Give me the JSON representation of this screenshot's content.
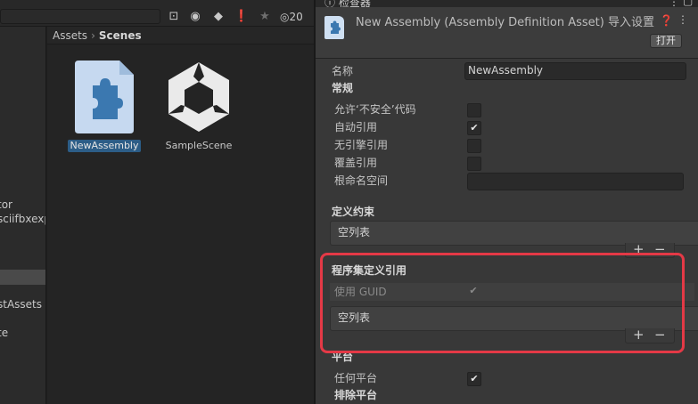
{
  "project": {
    "toolbar_icons": [
      "scene-filter-icon",
      "palette-icon",
      "label-icon",
      "info-icon",
      "favorite-icon",
      "eye-hidden-icon"
    ],
    "hidden_count": "20",
    "tree_items": [
      "tor",
      "sciifbxexp",
      "stAssets",
      "te"
    ],
    "breadcrumb": {
      "root": "Assets",
      "separator": "›",
      "current": "Scenes"
    },
    "assets": [
      {
        "label": "NewAssembly",
        "icon": "assembly-definition-icon",
        "selected": true
      },
      {
        "label": "SampleScene",
        "icon": "unity-scene-icon",
        "selected": false
      }
    ]
  },
  "inspector": {
    "tab_label": "检查器",
    "title": "New Assembly (Assembly Definition Asset) 导入设置",
    "open_button": "打开",
    "name_label": "名称",
    "name_value": "NewAssembly",
    "general_title": "常规",
    "general_rows": [
      {
        "label": "允许‘不安全’代码",
        "checked": false
      },
      {
        "label": "自动引用",
        "checked": true
      },
      {
        "label": "无引擎引用",
        "checked": false
      },
      {
        "label": "覆盖引用",
        "checked": false
      }
    ],
    "root_namespace_label": "根命名空间",
    "root_namespace_value": "",
    "define_constraints_title": "定义约束",
    "define_constraints_empty": "空列表",
    "assembly_refs_title": "程序集定义引用",
    "use_guid_label": "使用 GUID",
    "use_guid_checked": true,
    "assembly_refs_empty": "空列表",
    "platforms_title": "平台",
    "any_platform_label": "任何平台",
    "any_platform_checked": true,
    "exclude_platforms_title": "排除平台",
    "plus": "+",
    "minus": "−",
    "highlight_color": "#e43946"
  }
}
